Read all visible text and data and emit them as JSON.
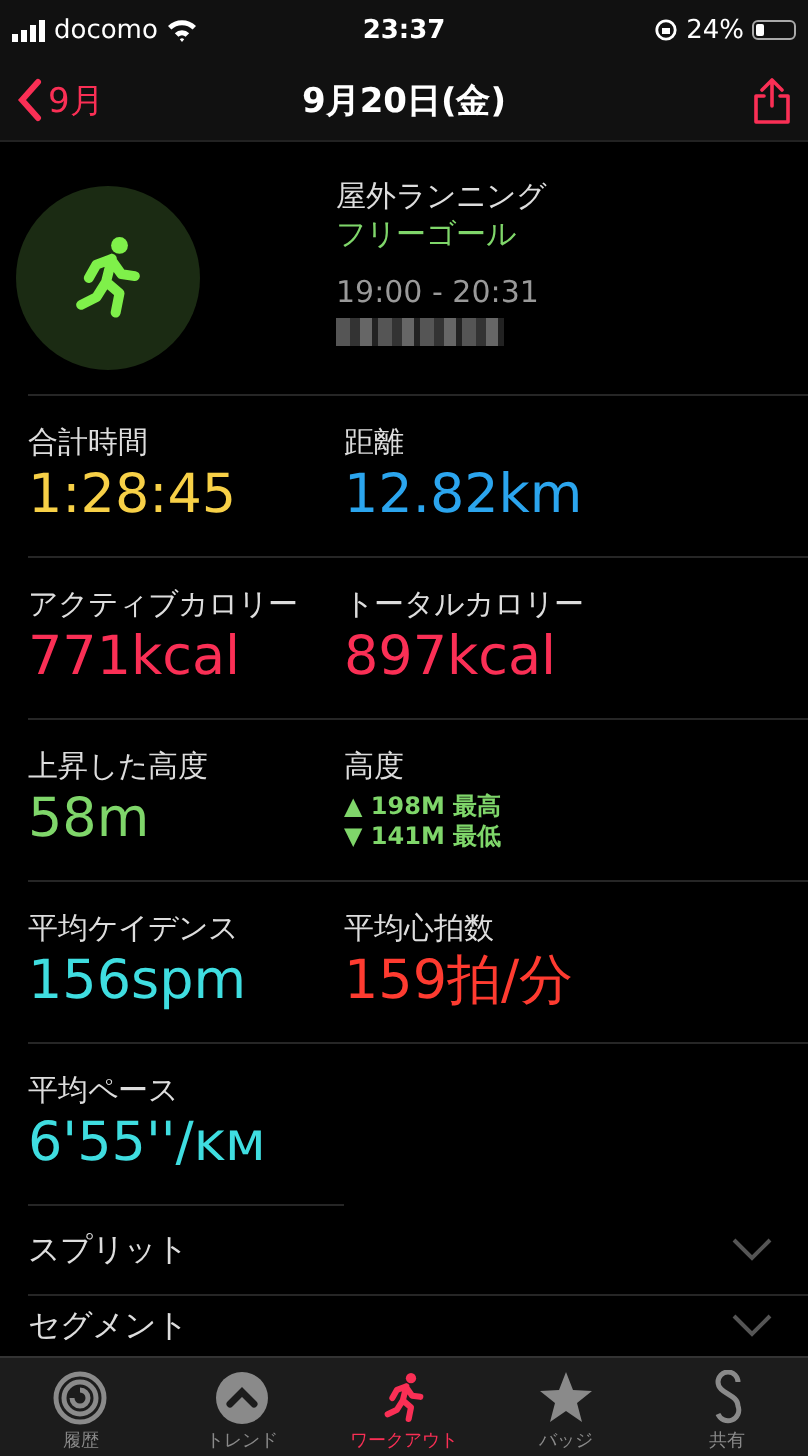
{
  "status_bar": {
    "carrier": "docomo",
    "time": "23:37",
    "battery": "24%"
  },
  "nav": {
    "back": "9月",
    "title": "9月20日(金)"
  },
  "workout": {
    "type": "屋外ランニング",
    "goal": "フリーゴール",
    "time_range": "19:00 - 20:31"
  },
  "metrics": [
    {
      "kind": "value",
      "label": "合計時間",
      "value": "1:28:45",
      "color": "#f7d047"
    },
    {
      "kind": "value",
      "label": "距離",
      "value": "12.82km",
      "color": "#2ba5ee"
    },
    {
      "kind": "value",
      "label": "アクティブカロリー",
      "value": "771kcal",
      "color": "#fa2f55"
    },
    {
      "kind": "value",
      "label": "トータルカロリー",
      "value": "897kcal",
      "color": "#fa2f55"
    },
    {
      "kind": "value",
      "label": "上昇した高度",
      "value": "58m",
      "color": "#7fd66a"
    },
    {
      "kind": "range",
      "label": "高度",
      "lines": [
        "▲ 198M 最高",
        "▼ 141M 最低"
      ],
      "color": "#7fd66a"
    },
    {
      "kind": "value",
      "label": "平均ケイデンス",
      "value": "156spm",
      "color": "#3fdde0"
    },
    {
      "kind": "value",
      "label": "平均心拍数",
      "value": "159拍/分",
      "color": "#fe3b30"
    },
    {
      "kind": "value",
      "label": "平均ペース",
      "value": "6'55''/ᴋᴍ",
      "color": "#3fdde0"
    }
  ],
  "sections": [
    {
      "label": "スプリット",
      "expanded": false
    },
    {
      "label": "セグメント",
      "expanded": false
    }
  ],
  "tabs": [
    {
      "label": "履歴",
      "kind": "rings",
      "selected": false
    },
    {
      "label": "トレンド",
      "kind": "trend",
      "selected": false
    },
    {
      "label": "ワークアウト",
      "kind": "runner",
      "selected": true
    },
    {
      "label": "バッジ",
      "kind": "star",
      "selected": false
    },
    {
      "label": "共有",
      "kind": "share",
      "selected": false
    }
  ]
}
